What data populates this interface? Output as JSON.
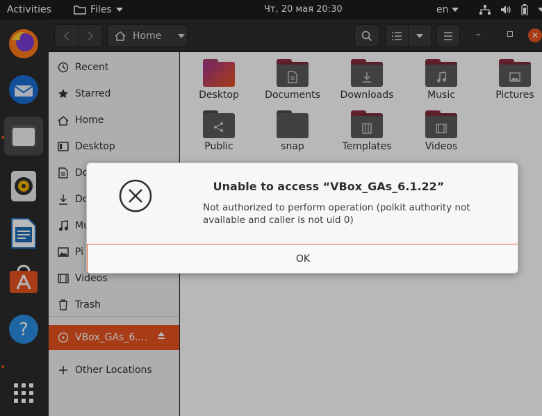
{
  "topbar": {
    "activities": "Activities",
    "app_menu": "Files",
    "clock": "Чт, 20 мая  20:30",
    "language": "en"
  },
  "headerbar": {
    "path_label": "Home"
  },
  "sidebar": {
    "items": [
      {
        "label": "Recent",
        "icon": "clock-icon"
      },
      {
        "label": "Starred",
        "icon": "star-icon"
      },
      {
        "label": "Home",
        "icon": "home-icon"
      },
      {
        "label": "Desktop",
        "icon": "desktop-icon"
      },
      {
        "label": "Do",
        "icon": "document-icon"
      },
      {
        "label": "Do",
        "icon": "download-icon"
      },
      {
        "label": "Mu",
        "icon": "music-icon"
      },
      {
        "label": "Pi",
        "icon": "picture-icon"
      },
      {
        "label": "Videos",
        "icon": "video-icon"
      },
      {
        "label": "Trash",
        "icon": "trash-icon"
      }
    ],
    "device": {
      "label": "VBox_GAs_6....",
      "icon": "disc-icon"
    },
    "other_locations": "Other Locations"
  },
  "files": [
    {
      "label": "Desktop",
      "color": "#c34d7a"
    },
    {
      "label": "Documents",
      "color": "#7c2b3b"
    },
    {
      "label": "Downloads",
      "color": "#7c2b3b"
    },
    {
      "label": "Music",
      "color": "#7c2b3b"
    },
    {
      "label": "Pictures",
      "color": "#7c2b3b"
    },
    {
      "label": "Public",
      "color": "#5a5a5a"
    },
    {
      "label": "snap",
      "color": "#5a5a5a"
    },
    {
      "label": "Templates",
      "color": "#7c2b3b"
    },
    {
      "label": "Videos",
      "color": "#7c2b3b"
    }
  ],
  "dialog": {
    "title": "Unable to access “VBox_GAs_6.1.22”",
    "message": "Not authorized to perform operation (polkit authority not available and caller is not uid 0)",
    "ok_label": "OK"
  },
  "colors": {
    "accent": "#e95420",
    "topbar": "#1d1d1d",
    "sidebar": "#f1f1f1"
  }
}
